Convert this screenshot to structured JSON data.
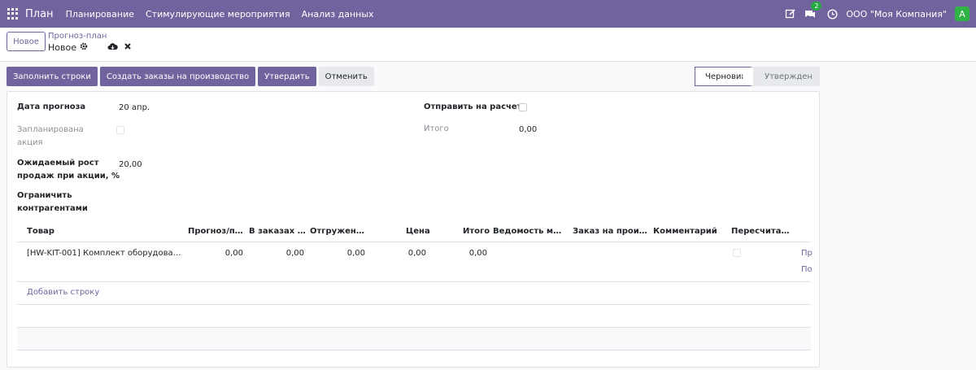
{
  "navbar": {
    "brand": "План",
    "menu": [
      "Планирование",
      "Стимулирующие мероприятия",
      "Анализ данных"
    ],
    "chat_badge": "2",
    "company": "ООО \"Моя Компания\"",
    "avatar_letter": "A"
  },
  "control": {
    "new_label": "Новое",
    "breadcrumb": "Прогноз-план",
    "record_name": "Новое"
  },
  "actions": {
    "fill_rows": "Заполнить строки",
    "create_orders": "Создать заказы на производство",
    "approve": "Утвердить",
    "cancel": "Отменить"
  },
  "status": {
    "draft": "Черновик",
    "approved": "Утвержден"
  },
  "form": {
    "forecast_date_label": "Дата прогноза",
    "forecast_date_value": "20 апр.",
    "planned_action_label_1": "Запланирована",
    "planned_action_label_2": "акция",
    "growth_label_1": "Ожидаемый рост",
    "growth_label_2": "продаж при акции, %",
    "growth_value": "20,00",
    "limit_label_1": "Ограничить",
    "limit_label_2": "контрагентами",
    "send_calc_label": "Отправить на расчет",
    "total_label": "Итого",
    "total_value": "0,00"
  },
  "table": {
    "headers": [
      "Товар",
      "Прогноз/пл...",
      "В заказах ф...",
      "Отгружено ...",
      "Цена",
      "Итого",
      "Ведомость мат...",
      "Заказ на произ...",
      "Комментарий",
      "Пересчитан..."
    ],
    "rows": [
      {
        "product": "[HW-KIT-001] Комплект оборудован...",
        "forecast": "0,00",
        "in_orders": "0,00",
        "shipped": "0,00",
        "price": "0,00",
        "total": "0,00",
        "link1": "Пр",
        "link2": "По"
      }
    ],
    "add_row": "Добавить строку"
  }
}
